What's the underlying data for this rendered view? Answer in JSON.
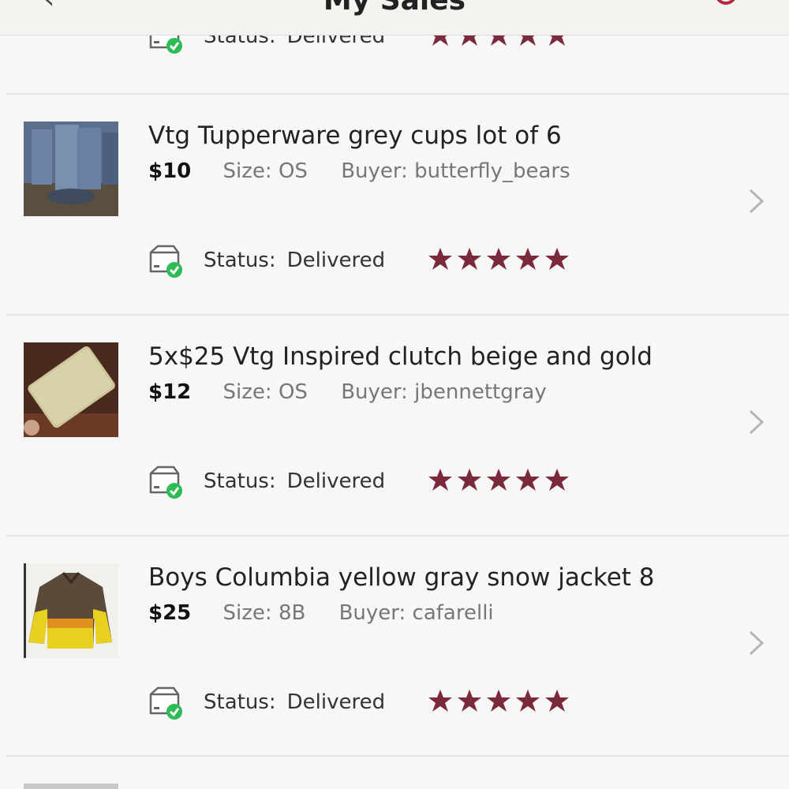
{
  "header": {
    "title": "My Sales"
  },
  "rows": [
    {
      "title": "Vtg Tupperware grey cups lot of 6",
      "price": "$10",
      "size": "Size: OS",
      "buyer": "Buyer: butterfly_bears",
      "status_label": "Status:",
      "status_value": "Delivered",
      "rating": 5
    },
    {
      "title": "5x$25 Vtg Inspired clutch beige and gold",
      "price": "$12",
      "size": "Size: OS",
      "buyer": "Buyer: jbennettgray",
      "status_label": "Status:",
      "status_value": "Delivered",
      "rating": 5
    },
    {
      "title": "Boys Columbia yellow gray snow jacket 8",
      "price": "$25",
      "size": "Size: 8B",
      "buyer": "Buyer: cafarelli",
      "status_label": "Status:",
      "status_value": "Delivered",
      "rating": 5
    }
  ],
  "partial_top": {
    "status_label": "Status:",
    "status_value": "Delivered",
    "rating": 5
  },
  "colors": {
    "star": "#7a2a3a",
    "check": "#2dbb55",
    "chevron": "#b5b5b5"
  },
  "icons": [
    "back-arrow-icon",
    "refresh-icon",
    "package-delivered-icon",
    "star-icon",
    "chevron-right-icon"
  ]
}
